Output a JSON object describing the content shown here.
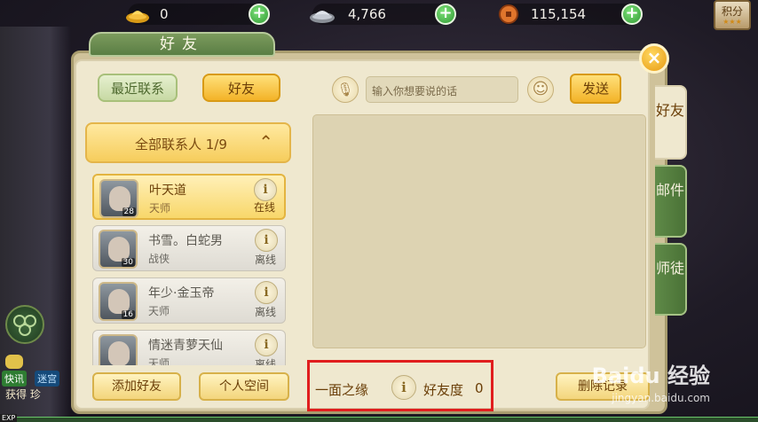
{
  "currencies": [
    {
      "name": "gold-ingot",
      "value": "0"
    },
    {
      "name": "silver-ingot",
      "value": "4,766"
    },
    {
      "name": "copper-coin",
      "value": "115,154"
    }
  ],
  "points_label": "积分",
  "panel": {
    "title": "好友",
    "tabs": {
      "recent": "最近联系",
      "friends": "好友"
    },
    "group_header": "全部联系人 1/9",
    "contacts": [
      {
        "name": "叶天道",
        "class": "天师",
        "level": "28",
        "status": "在线",
        "active": true
      },
      {
        "name": "书雪。白蛇男",
        "class": "战侠",
        "level": "30",
        "status": "离线",
        "active": false
      },
      {
        "name": "年少·金玉帝",
        "class": "天师",
        "level": "16",
        "status": "离线",
        "active": false
      },
      {
        "name": "情迷青萝天仙",
        "class": "天师",
        "level": "",
        "status": "离线",
        "active": false
      }
    ],
    "buttons": {
      "add_friend": "添加好友",
      "personal_space": "个人空间",
      "delete_records": "删除记录",
      "send": "发送"
    },
    "input_placeholder": "输入你想要说的话",
    "affinity": {
      "relation": "一面之缘",
      "label": "好友度",
      "value": "0"
    },
    "side_tabs": [
      "好友",
      "邮件",
      "师徒"
    ]
  },
  "chat_strip": {
    "tags": [
      "快讯",
      "迷宫"
    ],
    "line": "获得 珍"
  },
  "exp_label": "EXP",
  "watermark": {
    "brand": "Baidu 经验",
    "url": "jingyan.baidu.com"
  }
}
